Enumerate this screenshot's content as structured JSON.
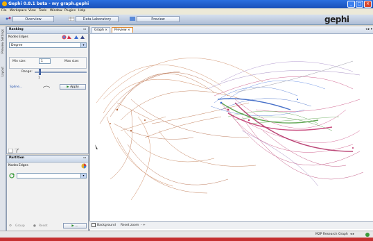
{
  "window": {
    "title": "Gephi 0.8.1 beta - my graph.gephi"
  },
  "menu": [
    "File",
    "Workspace",
    "View",
    "Tools",
    "Window",
    "Plugins",
    "Help"
  ],
  "nav": {
    "overview": "Overview",
    "data_lab": "Data Laboratory",
    "preview": "Preview",
    "logo": "gephi"
  },
  "side_tabs": {
    "preview_settings": "Preview Settings",
    "layout": "Layout"
  },
  "ranking": {
    "title": "Ranking",
    "tab_nodes": "Nodes",
    "tab_edges": "Edges",
    "combo_value": "Degree",
    "min_label": "Min size:",
    "min_value": "1",
    "max_label": "Max size:",
    "range_label": "Range:",
    "range_value": "1",
    "spline": "Spline...",
    "apply": "Apply"
  },
  "partition": {
    "title": "Partition",
    "tab_nodes": "Nodes",
    "tab_edges": "Edges",
    "group": "Group",
    "reset_label": "Reset"
  },
  "graph_tabs": {
    "graph": "Graph",
    "preview": "Preview"
  },
  "bottom": {
    "background": "Background",
    "reset_zoom": "Reset zoom"
  },
  "status": {
    "text": "M2P Research Graph"
  },
  "colors": {
    "title_bar": "#1950b8",
    "accent_orange": "#b05a2a",
    "accent_magenta": "#c0306a",
    "accent_blue": "#3a6ad0",
    "accent_green": "#4a9a3a"
  }
}
